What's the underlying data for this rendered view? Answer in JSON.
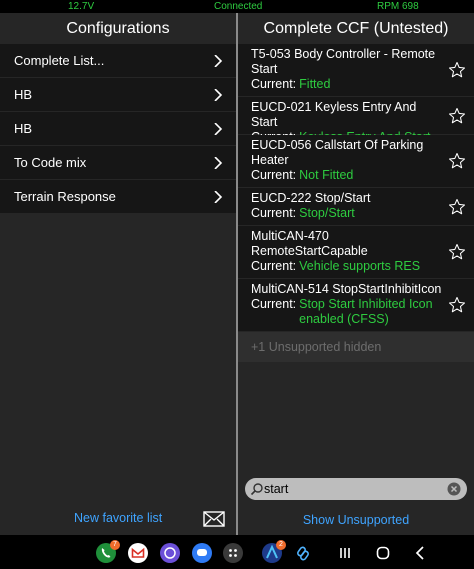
{
  "status": {
    "voltage": "12.7V",
    "connection": "Connected",
    "rpm": "RPM 698"
  },
  "left": {
    "title": "Configurations",
    "items": [
      {
        "label": "Complete List..."
      },
      {
        "label": "HB"
      },
      {
        "label": "HB"
      },
      {
        "label": "To Code mix"
      },
      {
        "label": "Terrain Response"
      }
    ],
    "new_favorite": "New favorite list"
  },
  "right": {
    "title": "Complete CCF (Untested)",
    "current_label": "Current:",
    "items": [
      {
        "name": "T5-053 Body Controller - Remote Start",
        "current": "Fitted"
      },
      {
        "name": "EUCD-021 Keyless Entry And Start",
        "current": "Keyless Entry And Start"
      },
      {
        "name": "EUCD-056 Callstart Of Parking Heater",
        "current": "Not Fitted"
      },
      {
        "name": "EUCD-222 Stop/Start",
        "current": "Stop/Start"
      },
      {
        "name": "MultiCAN-470 RemoteStartCapable",
        "current": "Vehicle supports RES"
      },
      {
        "name": "MultiCAN-514 StopStartInhibitIcon",
        "current": "Stop Start Inhibited Icon enabled (CFSS)"
      }
    ],
    "hidden_text": "+1 Unsupported hidden",
    "search_value": "start",
    "show_unsupported": "Show Unsupported"
  },
  "navbar": {
    "apps": [
      {
        "icon": "phone-icon",
        "color": "#1f8f3a",
        "badge": "7"
      },
      {
        "icon": "gmail-icon",
        "color": "#ffffff",
        "badge": ""
      },
      {
        "icon": "browser-icon",
        "color": "#6b4fd8",
        "badge": ""
      },
      {
        "icon": "messages-icon",
        "color": "#2f7bf5",
        "badge": ""
      },
      {
        "icon": "app-grid-icon",
        "color": "#3a3a3a",
        "badge": ""
      },
      {
        "icon": "arc-app-icon",
        "color": "#1e3a8a",
        "badge": "2"
      },
      {
        "icon": "chain-link-icon",
        "color": "#000000",
        "badge": ""
      }
    ]
  }
}
